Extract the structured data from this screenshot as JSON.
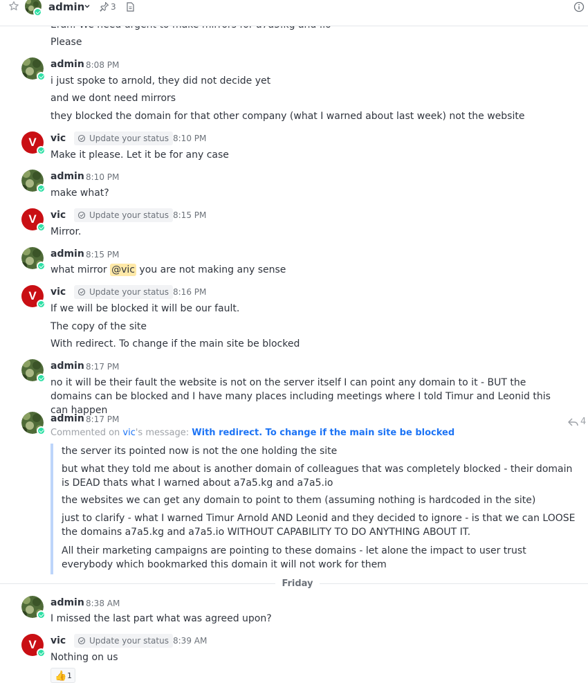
{
  "header": {
    "room_name": "admin",
    "pinned_count": "3"
  },
  "top_partial": {
    "cut_line": "Eran: We need urgent to make mirrors for a7a5.kg and .io",
    "line": "Please"
  },
  "status_label": "Update your status",
  "messages": [
    {
      "user": "admin",
      "time": "8:08 PM",
      "lines": [
        "i just spoke to arnold, they did not decide yet",
        "and we dont need mirrors",
        "they blocked the domain for that other company (what I warned about last week) not the website"
      ]
    },
    {
      "user": "vic",
      "time": "8:10 PM",
      "lines": [
        "Make it please. Let it be for any case"
      ]
    },
    {
      "user": "admin",
      "time": "8:10 PM",
      "lines": [
        "make what?"
      ]
    },
    {
      "user": "vic",
      "time": "8:15 PM",
      "lines": [
        "Mirror."
      ]
    },
    {
      "user": "admin",
      "time": "8:15 PM",
      "pre": "what mirror ",
      "mention": "@vic",
      "post": " you are not making any sense"
    },
    {
      "user": "vic",
      "time": "8:16 PM",
      "lines": [
        "If we will be blocked it will be our fault.",
        "The copy of the site",
        "With redirect. To change if the main site be blocked"
      ]
    },
    {
      "user": "admin",
      "time": "8:17 PM",
      "lines": [
        "no it will be their fault the website is not on the server itself I can point any domain to it - BUT the domains can be blocked and I have many places including meetings where I told Timur and Leonid this can happen"
      ]
    },
    {
      "user": "admin",
      "time": "8:17 PM",
      "commented_prefix": "Commented on ",
      "commented_user": "vic",
      "commented_mid": "'s message: ",
      "commented_msg": "With redirect. To change if the main site be blocked",
      "reply_count": "4",
      "quote_lines": [
        "the server its pointed now is not the one holding the site",
        "but what they told me about is another domain of colleagues that was completely blocked - their domain is DEAD thats what I warned about a7a5.kg and a7a5.io",
        "the websites we can get any domain to point to them (assuming nothing is hardcoded in the site)",
        "just to clarify - what I warned Timur Arnold AND Leonid and they decided to ignore - is that we can LOOSE the domains a7a5.kg and a7a5.io WITHOUT CAPABILITY TO DO ANYTHING ABOUT IT.",
        "All their marketing campaigns are pointing to these domains - let alone the impact to user trust everybody which bookmarked this domain it will not work for them"
      ]
    },
    {
      "user": "admin",
      "time": "8:38 AM",
      "lines": [
        "I missed the last part what was agreed upon?"
      ]
    },
    {
      "user": "vic",
      "time": "8:39 AM",
      "lines": [
        "Nothing on us"
      ],
      "reaction": {
        "emoji": "👍",
        "count": "1"
      }
    }
  ],
  "day_divider": "Friday",
  "colors": {
    "accent": "#1d74f5",
    "online": "#2de0a5",
    "vic_avatar": "#c90f14",
    "mention_bg": "#ffe9a8"
  }
}
